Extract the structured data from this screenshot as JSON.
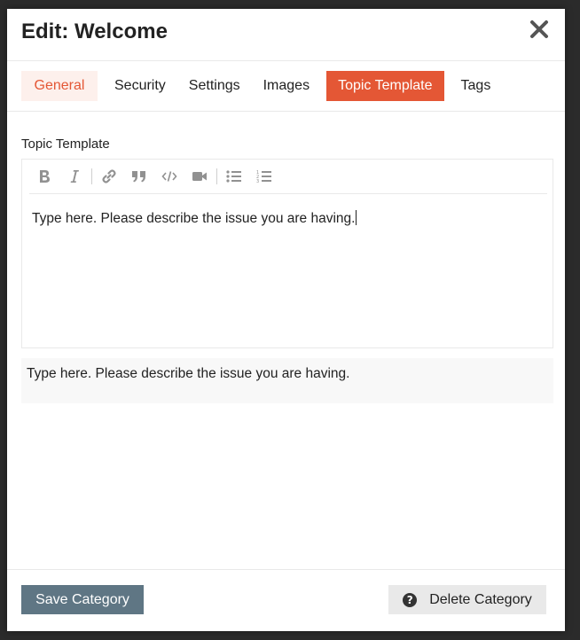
{
  "modal": {
    "title": "Edit: Welcome",
    "close_icon": "close-icon"
  },
  "tabs": [
    {
      "label": "General",
      "state": "highlighted"
    },
    {
      "label": "Security",
      "state": "normal"
    },
    {
      "label": "Settings",
      "state": "normal"
    },
    {
      "label": "Images",
      "state": "normal"
    },
    {
      "label": "Topic Template",
      "state": "active"
    },
    {
      "label": "Tags",
      "state": "normal"
    }
  ],
  "topic_template": {
    "label": "Topic Template",
    "editor_value": "Type here. Please describe the issue you are having.",
    "preview_text": "Type here. Please describe the issue you are having.",
    "toolbar": [
      "bold-icon",
      "italic-icon",
      "link-icon",
      "quote-icon",
      "code-icon",
      "video-icon",
      "bullet-list-icon",
      "numbered-list-icon"
    ]
  },
  "footer": {
    "save_label": "Save Category",
    "delete_label": "Delete Category",
    "delete_icon": "question-circle-icon"
  },
  "colors": {
    "accent": "#e45735",
    "accent_light": "#fdf0ec",
    "save_button": "#5f7684",
    "delete_button": "#e9e9e9"
  }
}
